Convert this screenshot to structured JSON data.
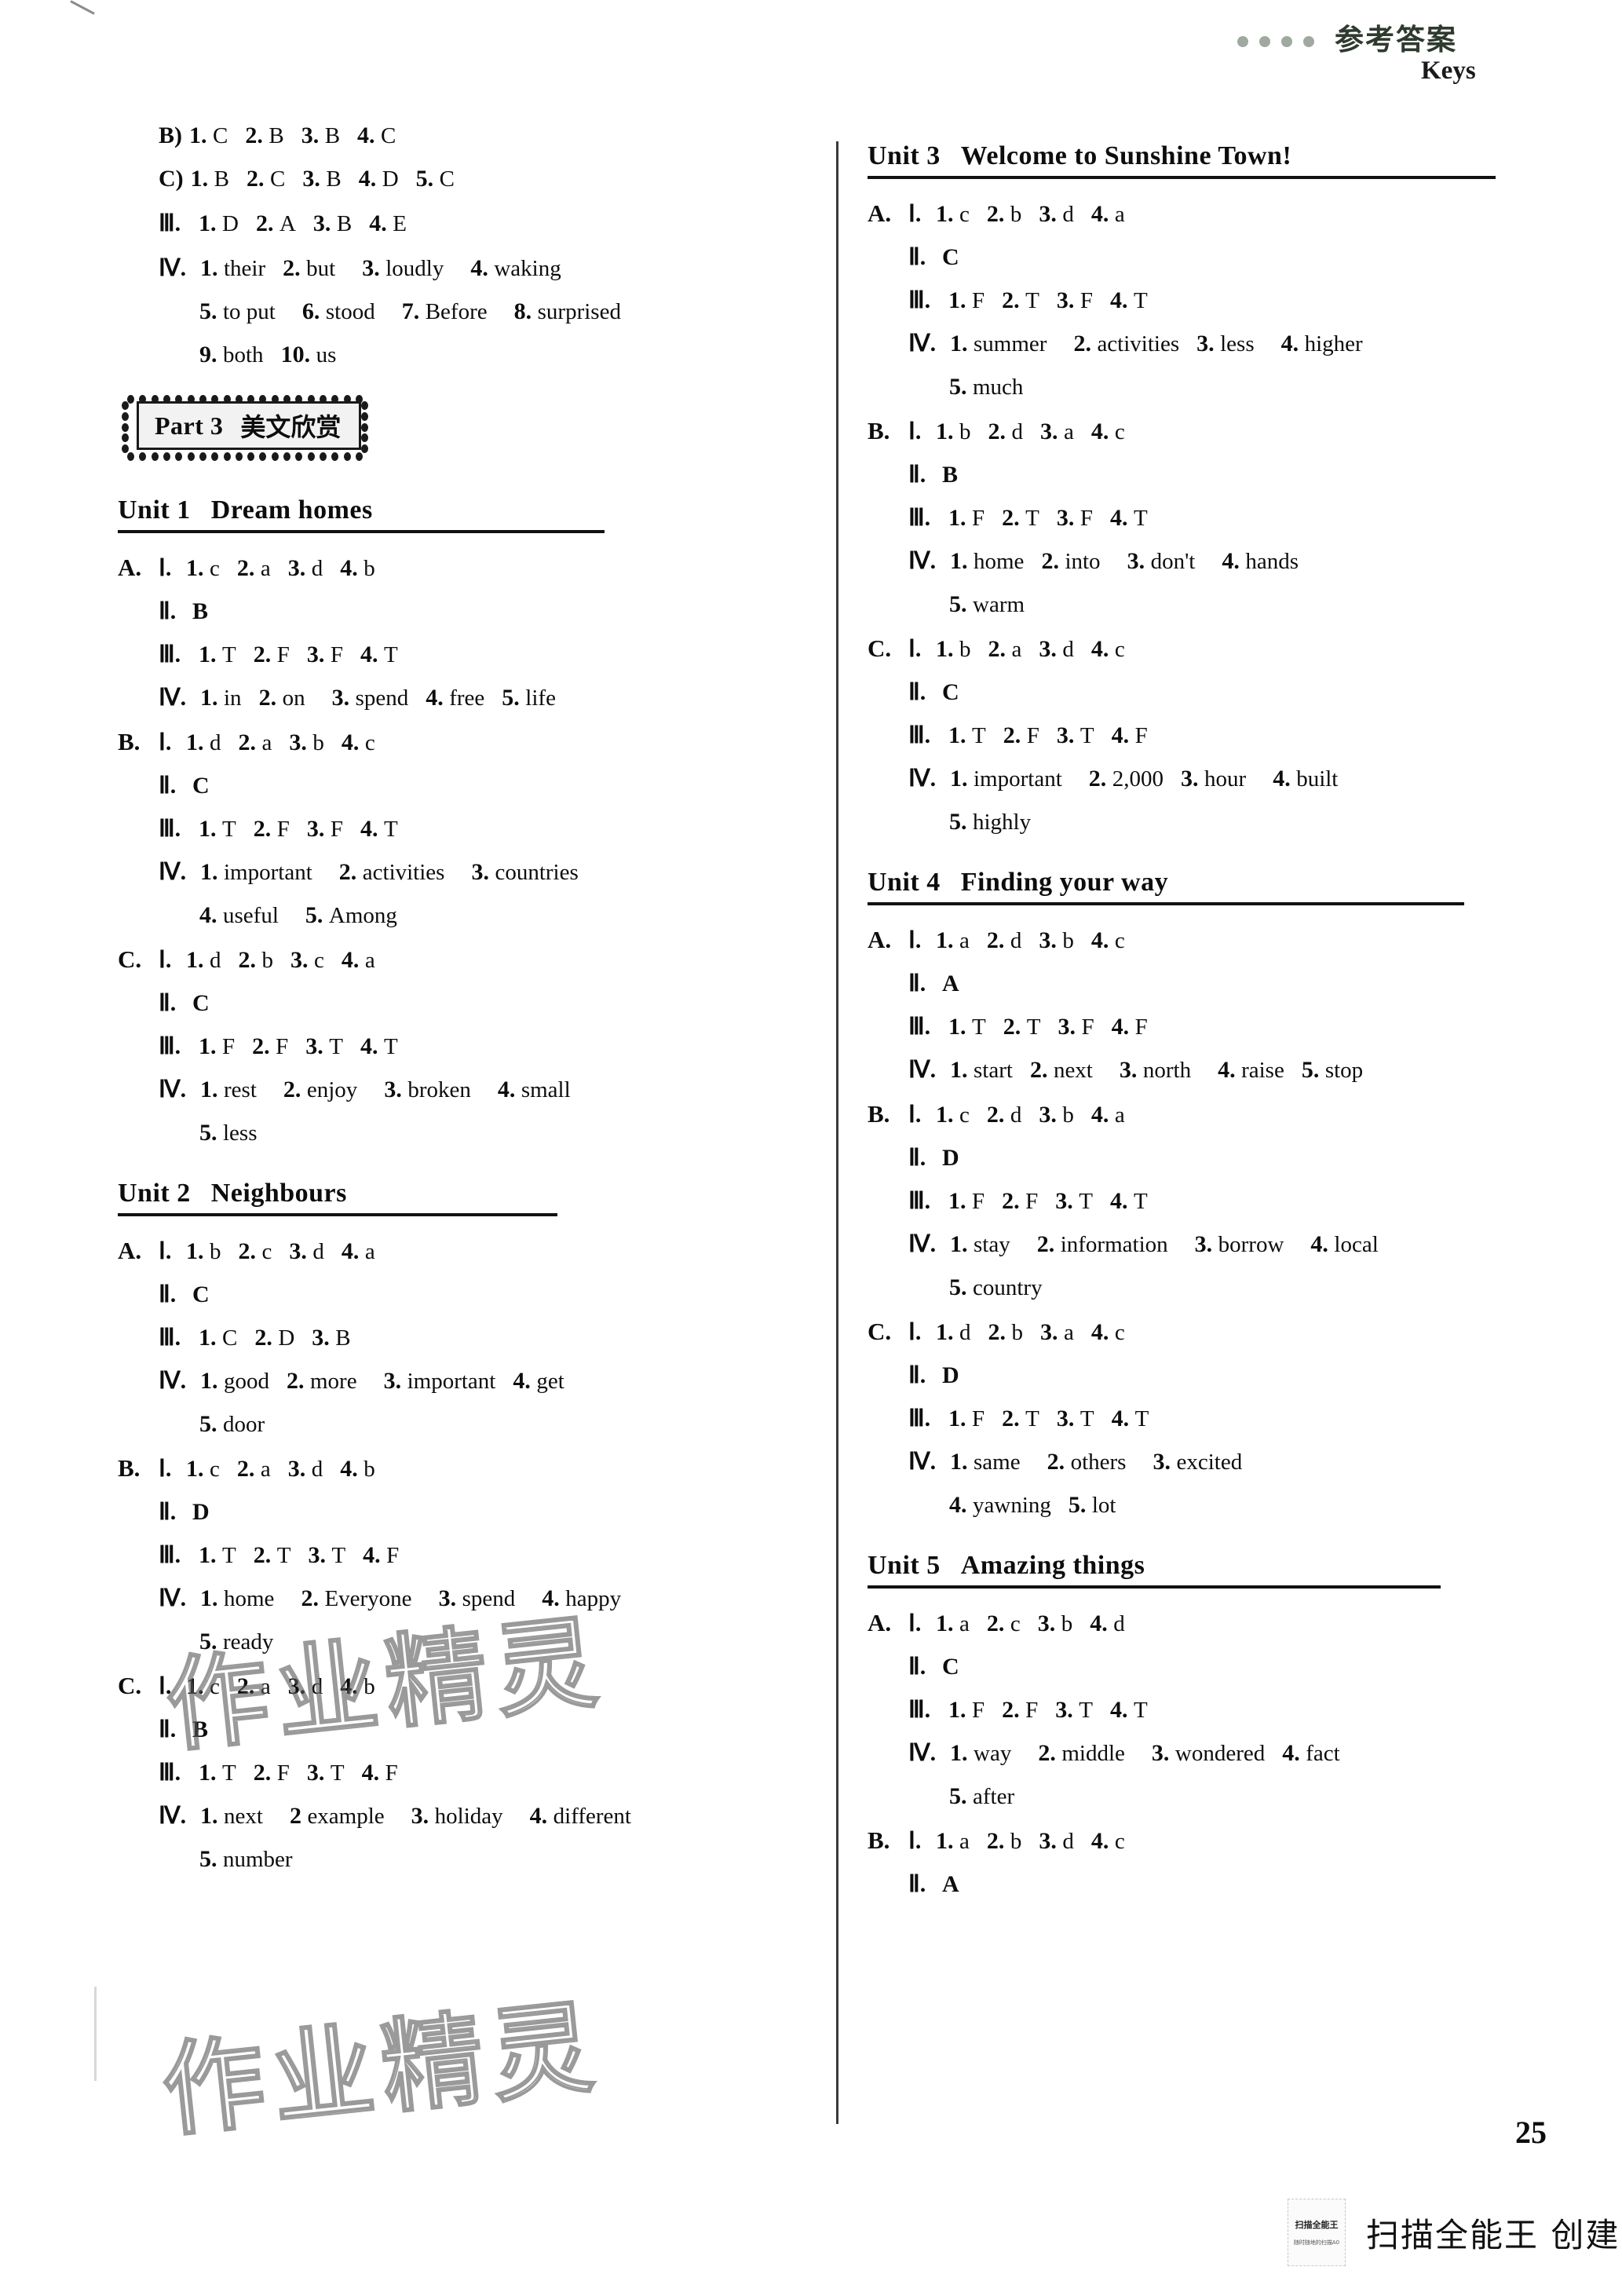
{
  "header": {
    "chinese_title": "参考答案",
    "english_title": "Keys"
  },
  "page_number": "25",
  "footer": {
    "qr_top_label": "扫描全能王",
    "qr_bottom_label": "随时随地的扫描A0",
    "text": "扫描全能王  创建"
  },
  "watermark": {
    "text": "作业精灵"
  },
  "part_banner": {
    "label": "Part 3",
    "chinese": "美文欣赏"
  },
  "left_column": {
    "top_answers": [
      {
        "section": "",
        "roman": "B)",
        "items": [
          "1. C",
          "2. B",
          "3. B",
          "4. C"
        ]
      },
      {
        "section": "",
        "roman": "C)",
        "items": [
          "1. B",
          "2. C",
          "3. B",
          "4. D",
          "5. C"
        ]
      },
      {
        "section": "",
        "roman": "Ⅲ.",
        "items": [
          "1. D",
          "2. A",
          "3. B",
          "4. E"
        ]
      },
      {
        "section": "",
        "roman": "Ⅳ.",
        "items": [
          "1. their",
          "2. but",
          "3. loudly",
          "4. waking"
        ]
      },
      {
        "section": "",
        "roman": "",
        "items": [
          "5. to put",
          "6. stood",
          "7. Before",
          "8. surprised"
        ]
      },
      {
        "section": "",
        "roman": "",
        "items": [
          "9. both",
          "10. us"
        ]
      }
    ],
    "units": [
      {
        "number": "Unit 1",
        "title": "Dream homes",
        "groups": [
          {
            "letter": "A.",
            "lines": [
              {
                "roman": "Ⅰ.",
                "items": [
                  "1. c",
                  "2. a",
                  "3. d",
                  "4. b"
                ]
              },
              {
                "roman": "Ⅱ.",
                "items": [
                  "B"
                ]
              },
              {
                "roman": "Ⅲ.",
                "items": [
                  "1. T",
                  "2. F",
                  "3. F",
                  "4. T"
                ]
              },
              {
                "roman": "Ⅳ.",
                "items": [
                  "1. in",
                  "2. on",
                  "3. spend",
                  "4. free",
                  "5. life"
                ]
              }
            ]
          },
          {
            "letter": "B.",
            "lines": [
              {
                "roman": "Ⅰ.",
                "items": [
                  "1. d",
                  "2. a",
                  "3. b",
                  "4. c"
                ]
              },
              {
                "roman": "Ⅱ.",
                "items": [
                  "C"
                ]
              },
              {
                "roman": "Ⅲ.",
                "items": [
                  "1. T",
                  "2. F",
                  "3. F",
                  "4. T"
                ]
              },
              {
                "roman": "Ⅳ.",
                "items": [
                  "1. important",
                  "2. activities",
                  "3. countries"
                ]
              },
              {
                "roman": "",
                "items": [
                  "4. useful",
                  "5. Among"
                ]
              }
            ]
          },
          {
            "letter": "C.",
            "lines": [
              {
                "roman": "Ⅰ.",
                "items": [
                  "1. d",
                  "2. b",
                  "3. c",
                  "4. a"
                ]
              },
              {
                "roman": "Ⅱ.",
                "items": [
                  "C"
                ]
              },
              {
                "roman": "Ⅲ.",
                "items": [
                  "1. F",
                  "2. F",
                  "3. T",
                  "4. T"
                ]
              },
              {
                "roman": "Ⅳ.",
                "items": [
                  "1. rest",
                  "2. enjoy",
                  "3. broken",
                  "4. small"
                ]
              },
              {
                "roman": "",
                "items": [
                  "5. less"
                ]
              }
            ]
          }
        ]
      },
      {
        "number": "Unit 2",
        "title": "Neighbours",
        "groups": [
          {
            "letter": "A.",
            "lines": [
              {
                "roman": "Ⅰ.",
                "items": [
                  "1. b",
                  "2. c",
                  "3. d",
                  "4. a"
                ]
              },
              {
                "roman": "Ⅱ.",
                "items": [
                  "C"
                ]
              },
              {
                "roman": "Ⅲ.",
                "items": [
                  "1. C",
                  "2. D",
                  "3. B"
                ]
              },
              {
                "roman": "Ⅳ.",
                "items": [
                  "1. good",
                  "2. more",
                  "3. important",
                  "4. get"
                ]
              },
              {
                "roman": "",
                "items": [
                  "5. door"
                ]
              }
            ]
          },
          {
            "letter": "B.",
            "lines": [
              {
                "roman": "Ⅰ.",
                "items": [
                  "1. c",
                  "2. a",
                  "3. d",
                  "4. b"
                ]
              },
              {
                "roman": "Ⅱ.",
                "items": [
                  "D"
                ]
              },
              {
                "roman": "Ⅲ.",
                "items": [
                  "1. T",
                  "2. T",
                  "3. T",
                  "4. F"
                ]
              },
              {
                "roman": "Ⅳ.",
                "items": [
                  "1. home",
                  "2. Everyone",
                  "3. spend",
                  "4. happy"
                ]
              },
              {
                "roman": "",
                "items": [
                  "5. ready"
                ]
              }
            ]
          },
          {
            "letter": "C.",
            "lines": [
              {
                "roman": "Ⅰ.",
                "items": [
                  "1. c",
                  "2. a",
                  "3. d",
                  "4. b"
                ]
              },
              {
                "roman": "Ⅱ.",
                "items": [
                  "B"
                ]
              },
              {
                "roman": "Ⅲ.",
                "items": [
                  "1. T",
                  "2. F",
                  "3. T",
                  "4. F"
                ]
              },
              {
                "roman": "Ⅳ.",
                "items": [
                  "1. next",
                  "2 example",
                  "3. holiday",
                  "4. different"
                ]
              },
              {
                "roman": "",
                "items": [
                  "5. number"
                ]
              }
            ]
          }
        ]
      }
    ]
  },
  "right_column": {
    "units": [
      {
        "number": "Unit 3",
        "title": "Welcome to Sunshine Town!",
        "groups": [
          {
            "letter": "A.",
            "lines": [
              {
                "roman": "Ⅰ.",
                "items": [
                  "1. c",
                  "2. b",
                  "3. d",
                  "4. a"
                ]
              },
              {
                "roman": "Ⅱ.",
                "items": [
                  "C"
                ]
              },
              {
                "roman": "Ⅲ.",
                "items": [
                  "1. F",
                  "2. T",
                  "3. F",
                  "4. T"
                ]
              },
              {
                "roman": "Ⅳ.",
                "items": [
                  "1. summer",
                  "2. activities",
                  "3. less",
                  "4. higher"
                ]
              },
              {
                "roman": "",
                "items": [
                  "5. much"
                ]
              }
            ]
          },
          {
            "letter": "B.",
            "lines": [
              {
                "roman": "Ⅰ.",
                "items": [
                  "1. b",
                  "2. d",
                  "3. a",
                  "4. c"
                ]
              },
              {
                "roman": "Ⅱ.",
                "items": [
                  "B"
                ]
              },
              {
                "roman": "Ⅲ.",
                "items": [
                  "1. F",
                  "2. T",
                  "3. F",
                  "4. T"
                ]
              },
              {
                "roman": "Ⅳ.",
                "items": [
                  "1. home",
                  "2. into",
                  "3. don't",
                  "4. hands"
                ]
              },
              {
                "roman": "",
                "items": [
                  "5. warm"
                ]
              }
            ]
          },
          {
            "letter": "C.",
            "lines": [
              {
                "roman": "Ⅰ.",
                "items": [
                  "1. b",
                  "2. a",
                  "3. d",
                  "4. c"
                ]
              },
              {
                "roman": "Ⅱ.",
                "items": [
                  "C"
                ]
              },
              {
                "roman": "Ⅲ.",
                "items": [
                  "1. T",
                  "2. F",
                  "3. T",
                  "4. F"
                ]
              },
              {
                "roman": "Ⅳ.",
                "items": [
                  "1. important",
                  "2. 2,000",
                  "3. hour",
                  "4. built"
                ]
              },
              {
                "roman": "",
                "items": [
                  "5. highly"
                ]
              }
            ]
          }
        ]
      },
      {
        "number": "Unit 4",
        "title": "Finding your way",
        "groups": [
          {
            "letter": "A.",
            "lines": [
              {
                "roman": "Ⅰ.",
                "items": [
                  "1. a",
                  "2. d",
                  "3. b",
                  "4. c"
                ]
              },
              {
                "roman": "Ⅱ.",
                "items": [
                  "A"
                ]
              },
              {
                "roman": "Ⅲ.",
                "items": [
                  "1. T",
                  "2. T",
                  "3. F",
                  "4. F"
                ]
              },
              {
                "roman": "Ⅳ.",
                "items": [
                  "1. start",
                  "2. next",
                  "3. north",
                  "4. raise",
                  "5. stop"
                ]
              }
            ]
          },
          {
            "letter": "B.",
            "lines": [
              {
                "roman": "Ⅰ.",
                "items": [
                  "1. c",
                  "2. d",
                  "3. b",
                  "4. a"
                ]
              },
              {
                "roman": "Ⅱ.",
                "items": [
                  "D"
                ]
              },
              {
                "roman": "Ⅲ.",
                "items": [
                  "1. F",
                  "2. F",
                  "3. T",
                  "4. T"
                ]
              },
              {
                "roman": "Ⅳ.",
                "items": [
                  "1. stay",
                  "2. information",
                  "3. borrow",
                  "4. local"
                ]
              },
              {
                "roman": "",
                "items": [
                  "5. country"
                ]
              }
            ]
          },
          {
            "letter": "C.",
            "lines": [
              {
                "roman": "Ⅰ.",
                "items": [
                  "1. d",
                  "2. b",
                  "3. a",
                  "4. c"
                ]
              },
              {
                "roman": "Ⅱ.",
                "items": [
                  "D"
                ]
              },
              {
                "roman": "Ⅲ.",
                "items": [
                  "1. F",
                  "2. T",
                  "3. T",
                  "4. T"
                ]
              },
              {
                "roman": "Ⅳ.",
                "items": [
                  "1. same",
                  "2. others",
                  "3. excited"
                ]
              },
              {
                "roman": "",
                "items": [
                  "4. yawning",
                  "5. lot"
                ]
              }
            ]
          }
        ]
      },
      {
        "number": "Unit 5",
        "title": "Amazing things",
        "groups": [
          {
            "letter": "A.",
            "lines": [
              {
                "roman": "Ⅰ.",
                "items": [
                  "1. a",
                  "2. c",
                  "3. b",
                  "4. d"
                ]
              },
              {
                "roman": "Ⅱ.",
                "items": [
                  "C"
                ]
              },
              {
                "roman": "Ⅲ.",
                "items": [
                  "1. F",
                  "2. F",
                  "3. T",
                  "4. T"
                ]
              },
              {
                "roman": "Ⅳ.",
                "items": [
                  "1. way",
                  "2. middle",
                  "3. wondered",
                  "4. fact"
                ]
              },
              {
                "roman": "",
                "items": [
                  "5. after"
                ]
              }
            ]
          },
          {
            "letter": "B.",
            "lines": [
              {
                "roman": "Ⅰ.",
                "items": [
                  "1. a",
                  "2. b",
                  "3. d",
                  "4. c"
                ]
              },
              {
                "roman": "Ⅱ.",
                "items": [
                  "A"
                ]
              }
            ]
          }
        ]
      }
    ]
  }
}
